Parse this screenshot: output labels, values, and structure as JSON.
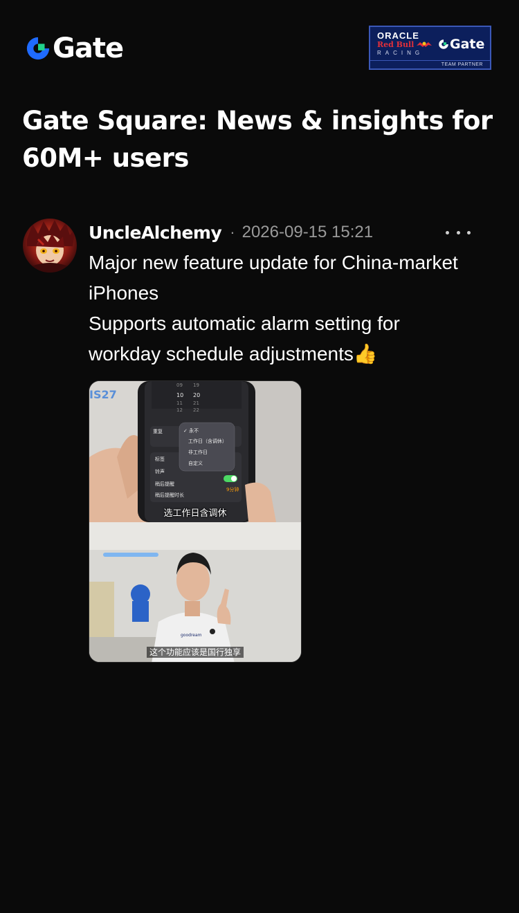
{
  "brand": {
    "logo_text": "Gate",
    "logo_icon": "gate-logo-icon",
    "accent_blue": "#1f6bff",
    "accent_green": "#21d18b"
  },
  "partner_badge": {
    "oracle": "ORACLE",
    "redbull": "Red Bull",
    "racing": "RACING",
    "gate": "Gate",
    "partner": "TEAM PARTNER"
  },
  "page": {
    "title": "Gate Square: News & insights for 60M+ users"
  },
  "post": {
    "username": "UncleAlchemy",
    "separator": "·",
    "timestamp": "2026-09-15 15:21",
    "more_icon": "more-horizontal-icon",
    "lines": [
      "Major new feature update for China-market",
      "iPhones",
      "Supports automatic alarm setting for",
      "workday schedule adjustments👍"
    ],
    "media": {
      "ios_label": "IS27",
      "top_caption": "选工作日含调休",
      "bottom_caption": "这个功能应该是国行独享",
      "menu_items": [
        "✓ 永不",
        "工作日（含调休）",
        "非工作日",
        "自定义"
      ],
      "settings_rows": [
        "重复",
        "标签",
        "铃声",
        "稍后提醒",
        "稍后提醒时长"
      ],
      "snooze_value": "9分钟",
      "time_cols": [
        "09",
        "10",
        "11",
        "12",
        "19",
        "20",
        "21",
        "22"
      ],
      "shirt_text": "goodream"
    }
  }
}
